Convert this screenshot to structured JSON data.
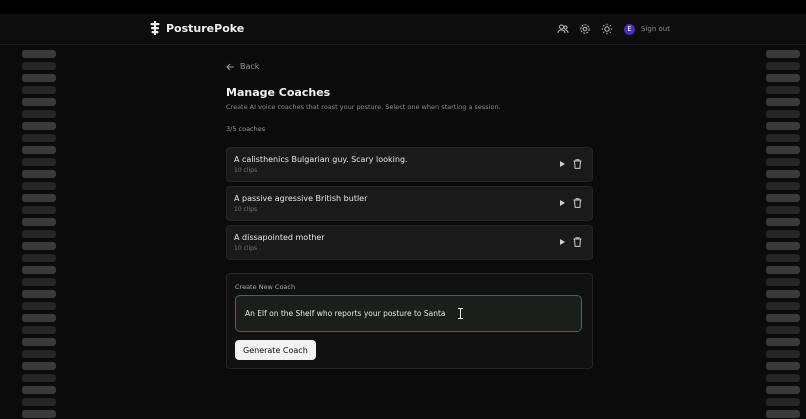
{
  "header": {
    "brand": "PosturePoke",
    "avatar_initial": "E",
    "signout_label": "Sign out"
  },
  "page": {
    "back_label": "Back",
    "title": "Manage Coaches",
    "subtitle": "Create AI voice coaches that roast your posture. Select one when starting a session.",
    "count": "3/5 coaches"
  },
  "coaches": [
    {
      "name": "A calisthenics Bulgarian guy. Scary looking.",
      "clips": "10 clips"
    },
    {
      "name": "A passive agressive British butler",
      "clips": "10 clips"
    },
    {
      "name": "A dissapointed mother",
      "clips": "10 clips"
    }
  ],
  "create": {
    "label": "Create New Coach",
    "input_value": "An Elf on the Shelf who reports your posture to Santa",
    "button_label": "Generate Coach"
  },
  "colors": {
    "accent_avatar": "#4a2bbd",
    "input_border": "#3d6b57"
  }
}
